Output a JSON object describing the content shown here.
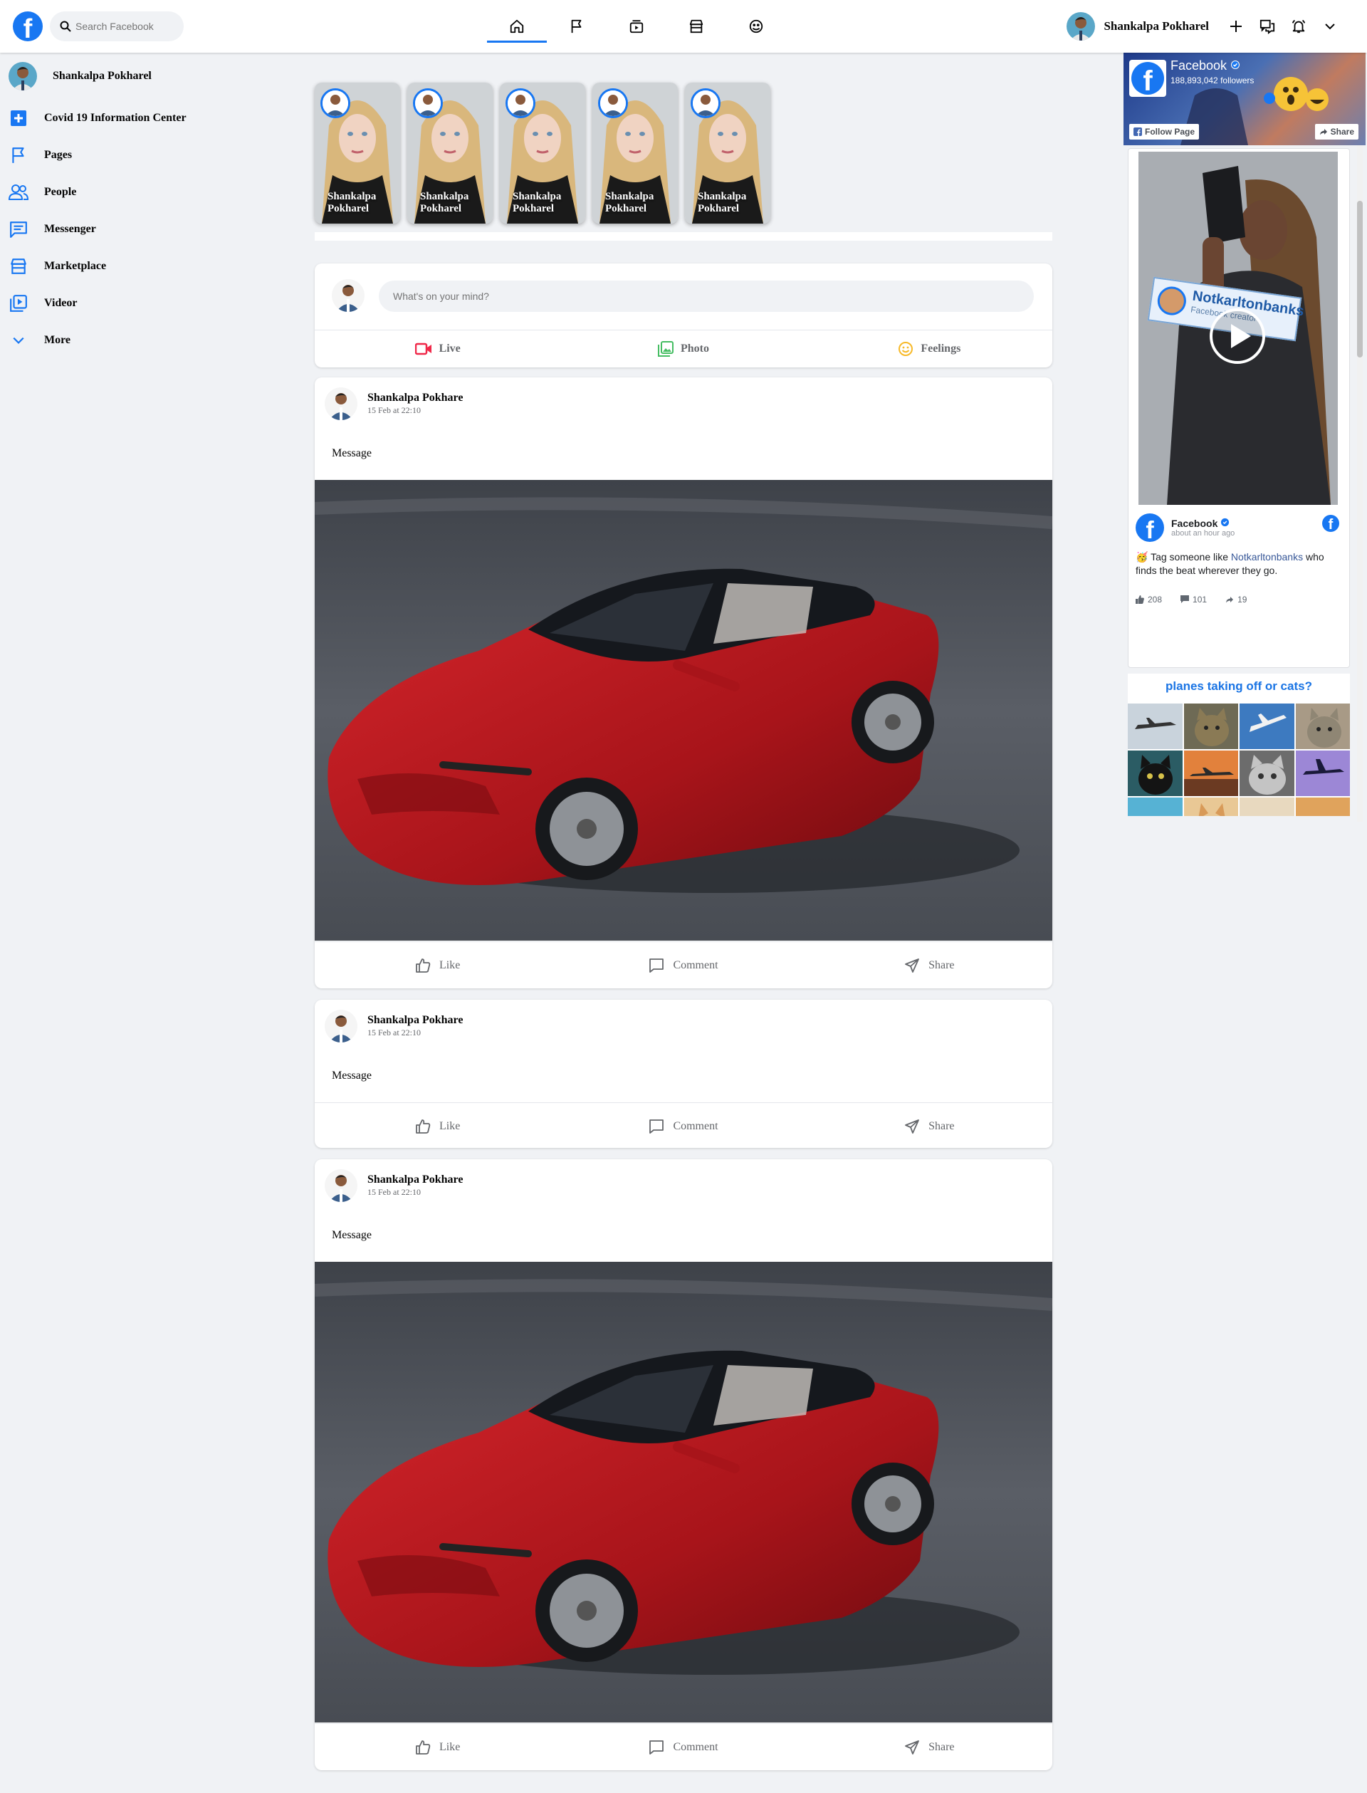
{
  "header": {
    "search_placeholder": "Search Facebook",
    "user_name": "Shankalpa Pokharel",
    "nav": [
      "home",
      "pages",
      "watch",
      "marketplace",
      "groups"
    ],
    "accent_color": "#1877f2"
  },
  "sidebar": {
    "profile_name": "Shankalpa Pokharel",
    "items": [
      {
        "label": "Covid 19 Information Center",
        "icon": "plus-box-icon"
      },
      {
        "label": "Pages",
        "icon": "flag-icon"
      },
      {
        "label": "People",
        "icon": "people-icon"
      },
      {
        "label": "Messenger",
        "icon": "chat-icon"
      },
      {
        "label": "Marketplace",
        "icon": "store-icon"
      },
      {
        "label": "Videor",
        "icon": "video-icon"
      },
      {
        "label": "More",
        "icon": "chevron-down-icon"
      }
    ]
  },
  "stories": [
    {
      "first": "Shankalpa",
      "last": "Pokharel"
    },
    {
      "first": "Shankalpa",
      "last": "Pokharel"
    },
    {
      "first": "Shankalpa",
      "last": "Pokharel"
    },
    {
      "first": "Shankalpa",
      "last": "Pokharel"
    },
    {
      "first": "Shankalpa",
      "last": "Pokharel"
    }
  ],
  "composer": {
    "placeholder": "What's on your mind?",
    "live": "Live",
    "photo": "Photo",
    "feelings": "Feelings"
  },
  "posts": [
    {
      "author": "Shankalpa Pokhare",
      "time": "15 Feb at 22:10",
      "message": "Message",
      "has_image": true,
      "like": "Like",
      "comment": "Comment",
      "share": "Share"
    },
    {
      "author": "Shankalpa Pokhare",
      "time": "15 Feb at 22:10",
      "message": "Message",
      "has_image": false,
      "like": "Like",
      "comment": "Comment",
      "share": "Share"
    },
    {
      "author": "Shankalpa Pokhare",
      "time": "15 Feb at 22:10",
      "message": "Message",
      "has_image": true,
      "like": "Like",
      "comment": "Comment",
      "share": "Share"
    }
  ],
  "right_rail": {
    "page_name": "Facebook",
    "followers": "188,893,042 followers",
    "follow_button": "Follow Page",
    "share_button": "Share",
    "post_author": "Facebook",
    "post_time": "about an hour ago",
    "post_text_before": "🥳 Tag someone like ",
    "post_link": "Notkarltonbanks",
    "post_text_after": " who finds the beat wherever they go.",
    "video_sign": "Notkarltonbanks",
    "video_sign_sub": "Facebook creator",
    "likes": "208",
    "comments": "101",
    "shares": "19",
    "poll_title": "planes taking off or cats?"
  }
}
